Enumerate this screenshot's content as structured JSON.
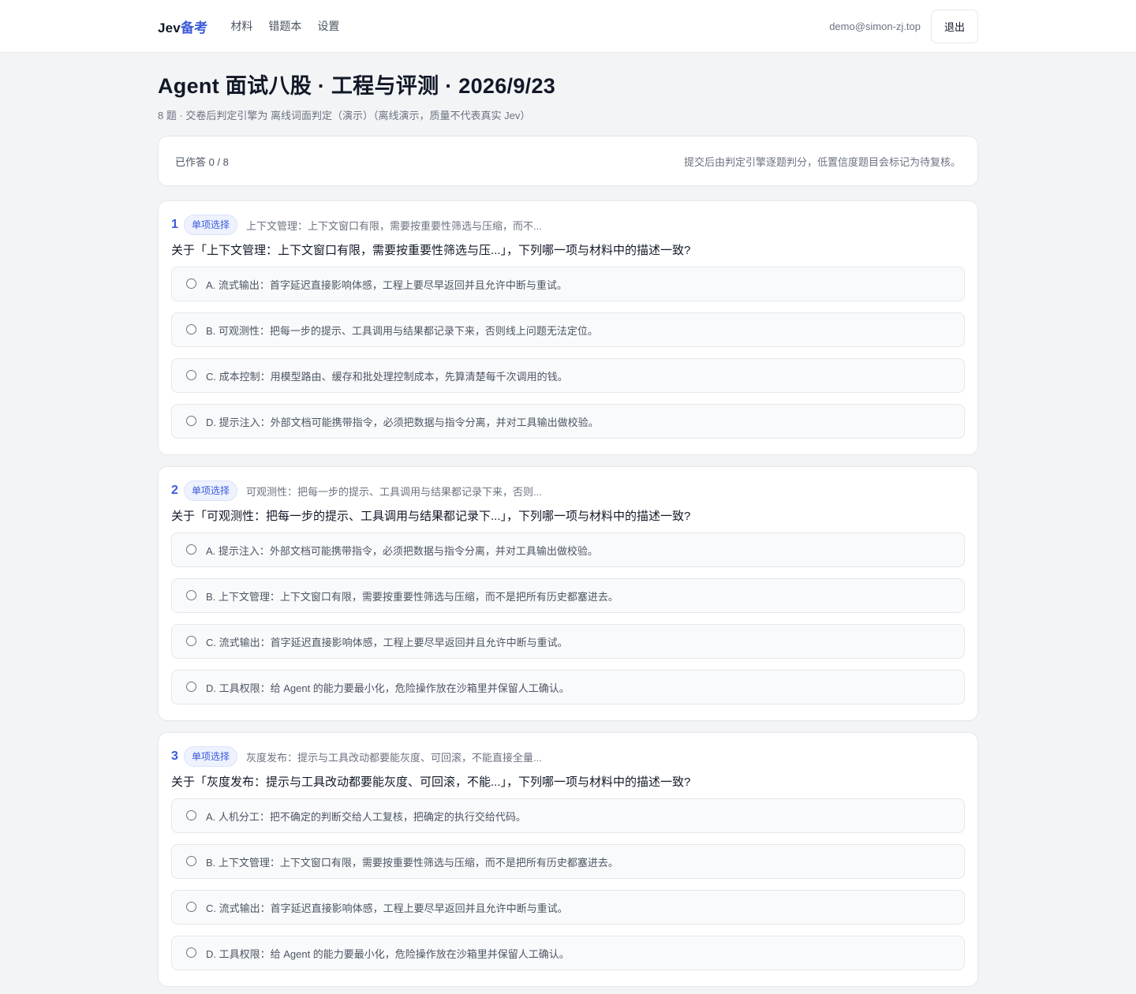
{
  "header": {
    "brand_prefix": "Jev",
    "brand_accent": "备考",
    "nav": [
      "材料",
      "错题本",
      "设置"
    ],
    "user_email": "demo@simon-zj.top",
    "logout_label": "退出"
  },
  "page": {
    "title": "Agent 面试八股 · 工程与评测 · 2026/9/23",
    "subtitle": "8 题 · 交卷后判定引擎为 离线词面判定（演示）（离线演示，质量不代表真实 Jev）"
  },
  "status": {
    "answered": "已作答 0 / 8",
    "note": "提交后由判定引擎逐题判分，低置信度题目会标记为待复核。"
  },
  "questions": [
    {
      "num": "1",
      "type": "单项选择",
      "topic": "上下文管理：上下文窗口有限，需要按重要性筛选与压缩，而不...",
      "text": "关于「上下文管理：上下文窗口有限，需要按重要性筛选与压...」，下列哪一项与材料中的描述一致?",
      "options": [
        "A. 流式输出：首字延迟直接影响体感，工程上要尽早返回并且允许中断与重试。",
        "B. 可观测性：把每一步的提示、工具调用与结果都记录下来，否则线上问题无法定位。",
        "C. 成本控制：用模型路由、缓存和批处理控制成本，先算清楚每千次调用的钱。",
        "D. 提示注入：外部文档可能携带指令，必须把数据与指令分离，并对工具输出做校验。"
      ]
    },
    {
      "num": "2",
      "type": "单项选择",
      "topic": "可观测性：把每一步的提示、工具调用与结果都记录下来，否则...",
      "text": "关于「可观测性：把每一步的提示、工具调用与结果都记录下...」，下列哪一项与材料中的描述一致?",
      "options": [
        "A. 提示注入：外部文档可能携带指令，必须把数据与指令分离，并对工具输出做校验。",
        "B. 上下文管理：上下文窗口有限，需要按重要性筛选与压缩，而不是把所有历史都塞进去。",
        "C. 流式输出：首字延迟直接影响体感，工程上要尽早返回并且允许中断与重试。",
        "D. 工具权限：给 Agent 的能力要最小化，危险操作放在沙箱里并保留人工确认。"
      ]
    },
    {
      "num": "3",
      "type": "单项选择",
      "topic": "灰度发布：提示与工具改动都要能灰度、可回滚，不能直接全量...",
      "text": "关于「灰度发布：提示与工具改动都要能灰度、可回滚，不能...」，下列哪一项与材料中的描述一致?",
      "options": [
        "A. 人机分工：把不确定的判断交给人工复核，把确定的执行交给代码。",
        "B. 上下文管理：上下文窗口有限，需要按重要性筛选与压缩，而不是把所有历史都塞进去。",
        "C. 流式输出：首字延迟直接影响体感，工程上要尽早返回并且允许中断与重试。",
        "D. 工具权限：给 Agent 的能力要最小化，危险操作放在沙箱里并保留人工确认。"
      ]
    }
  ]
}
